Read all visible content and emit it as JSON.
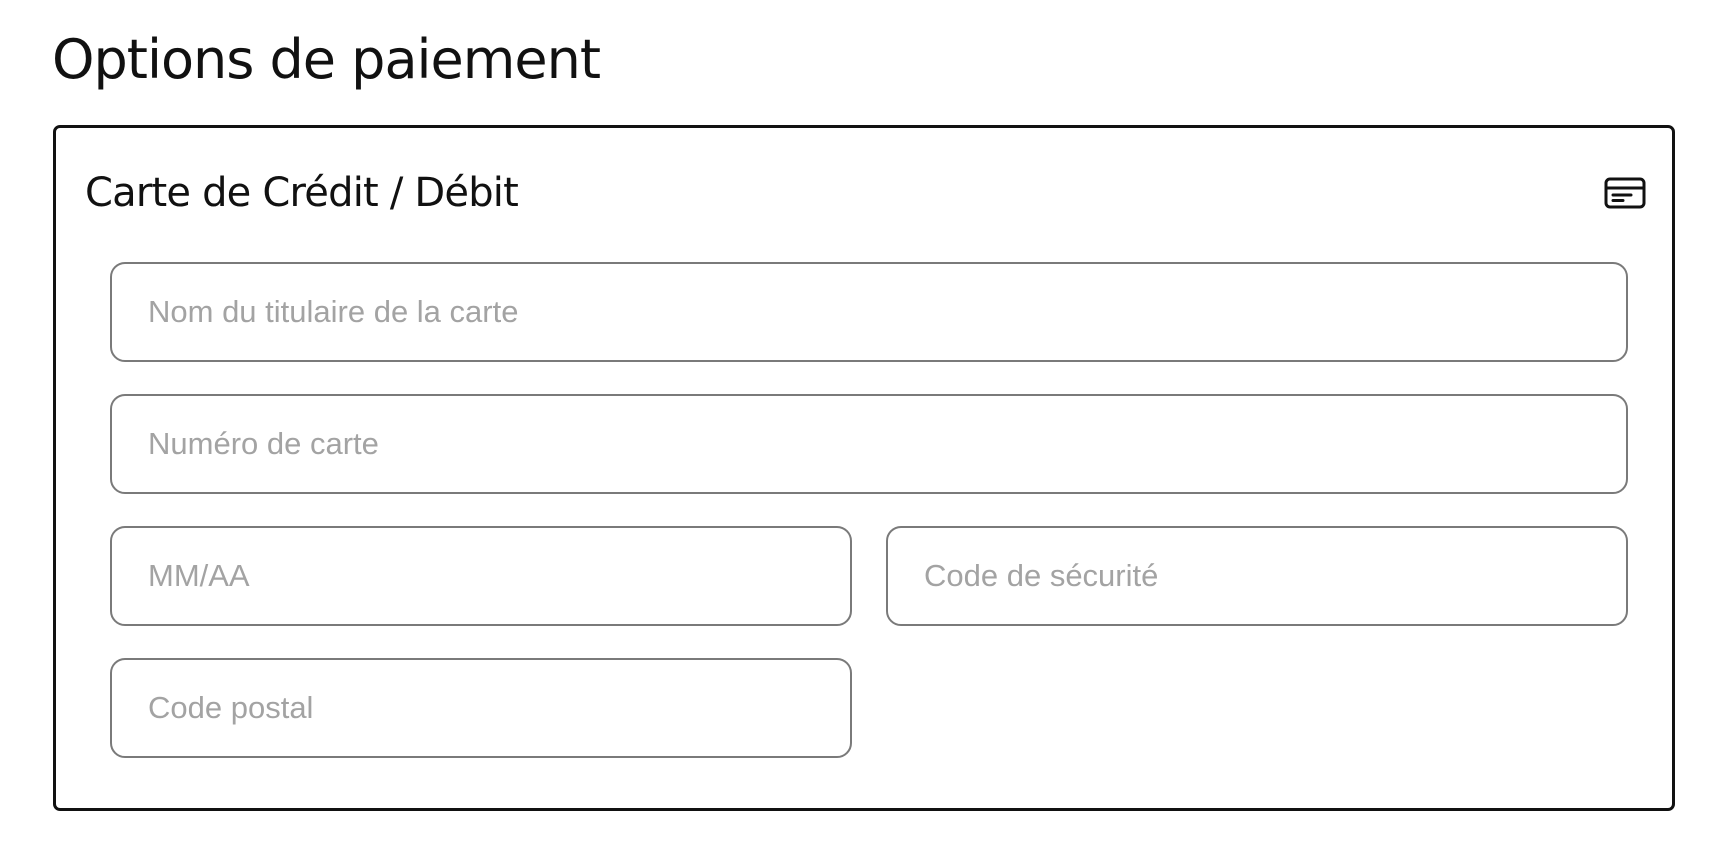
{
  "page": {
    "title": "Options de paiement"
  },
  "payment_panel": {
    "title": "Carte de Crédit / Débit",
    "icon": "credit-card-icon",
    "fields": {
      "cardholder_name": {
        "value": "",
        "placeholder": "Nom du titulaire de la carte"
      },
      "card_number": {
        "value": "",
        "placeholder": "Numéro de carte"
      },
      "expiry": {
        "value": "",
        "placeholder": "MM/AA"
      },
      "security_code": {
        "value": "",
        "placeholder": "Code de sécurité"
      },
      "postal_code": {
        "value": "",
        "placeholder": "Code postal"
      }
    }
  },
  "colors": {
    "text": "#111111",
    "panel_border": "#111111",
    "field_border": "#7a7a7a",
    "placeholder": "#a3a3a3",
    "background": "#ffffff"
  }
}
